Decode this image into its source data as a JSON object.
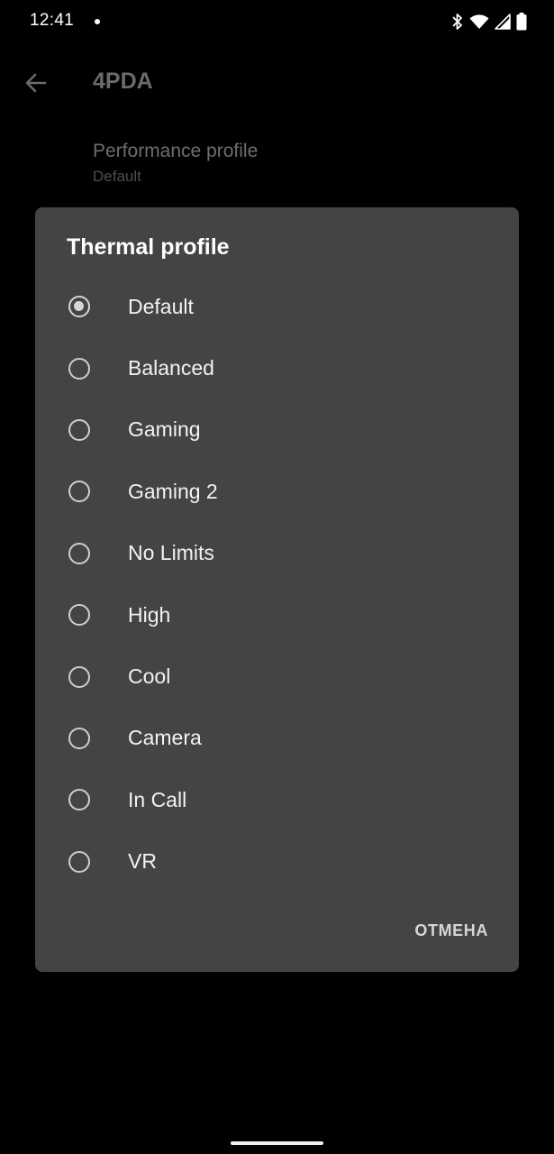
{
  "status_bar": {
    "time": "12:41",
    "icons": [
      "bluetooth-icon",
      "wifi-icon",
      "signal-icon",
      "battery-icon"
    ]
  },
  "app_bar": {
    "title": "4PDA"
  },
  "preference": {
    "title": "Performance profile",
    "summary": "Default"
  },
  "dialog": {
    "title": "Thermal profile",
    "options": [
      {
        "label": "Default",
        "selected": true
      },
      {
        "label": "Balanced",
        "selected": false
      },
      {
        "label": "Gaming",
        "selected": false
      },
      {
        "label": "Gaming 2",
        "selected": false
      },
      {
        "label": "No Limits",
        "selected": false
      },
      {
        "label": "High",
        "selected": false
      },
      {
        "label": "Cool",
        "selected": false
      },
      {
        "label": "Camera",
        "selected": false
      },
      {
        "label": "In Call",
        "selected": false
      },
      {
        "label": "VR",
        "selected": false
      }
    ],
    "cancel_label": "ОТМЕНА"
  },
  "colors": {
    "background": "#000000",
    "dialog_background": "#444444",
    "text_primary": "#f2f2f2",
    "radio": "#cfcfcf"
  }
}
